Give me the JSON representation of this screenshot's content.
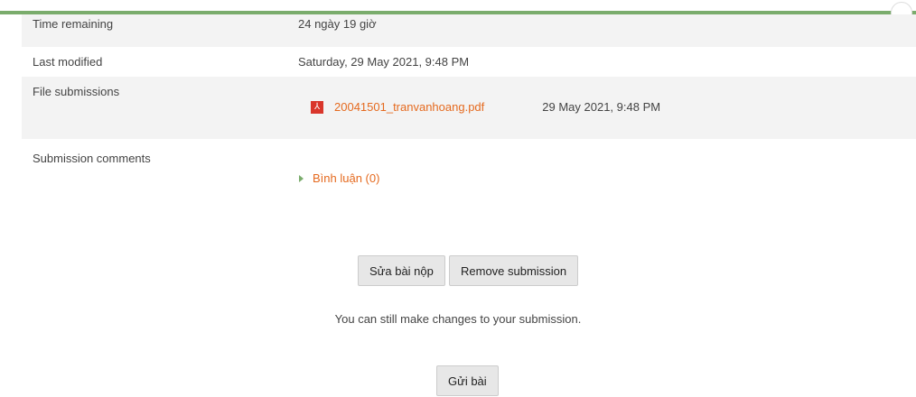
{
  "status": {
    "time_remaining_label": "Time remaining",
    "time_remaining_value": "24 ngày 19 giờ",
    "last_modified_label": "Last modified",
    "last_modified_value": "Saturday, 29 May 2021, 9:48 PM",
    "file_submissions_label": "File submissions",
    "file": {
      "icon": "pdf-icon",
      "name": "20041501_tranvanhoang.pdf",
      "date": "29 May 2021, 9:48 PM"
    },
    "submission_comments_label": "Submission comments",
    "comments_link": "Bình luận (0)"
  },
  "actions": {
    "edit_label": "Sửa bài nộp",
    "remove_label": "Remove submission",
    "note": "You can still make changes to your submission.",
    "submit_label": "Gửi bài"
  },
  "colors": {
    "accent_bar": "#7aac6c",
    "link": "#e56a1f",
    "pdf_icon": "#d9362b"
  }
}
